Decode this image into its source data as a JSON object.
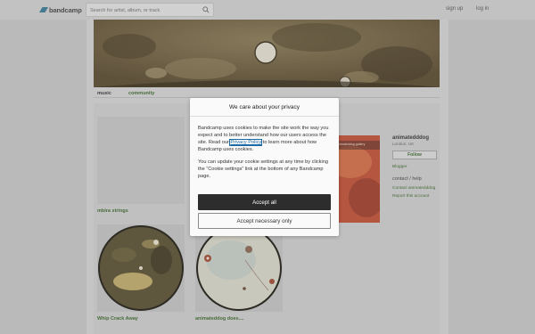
{
  "header": {
    "logo_text": "bandcamp",
    "search_placeholder": "Search for artist, album, or track",
    "signup_label": "sign up",
    "login_label": "log in"
  },
  "nav": {
    "music_label": "music",
    "community_label": "community"
  },
  "albums": [
    {
      "title": "mbira strings"
    },
    {
      "title": "Whip Crack Away"
    },
    {
      "title": "animateddog does...."
    }
  ],
  "featured_art_caption": "animateddog.gallery",
  "sidebar": {
    "band_name": "animatedddog",
    "location": "London, UK",
    "follow_label": "Follow",
    "blogger_link": "Blogger",
    "contact_heading": "contact / help",
    "contact_link": "Contact animatedddog",
    "report_link": "Report this account"
  },
  "cookie_modal": {
    "title": "We care about your privacy",
    "body_before_link": "Bandcamp uses cookies to make the site work the way you expect and to better understand how our users access the site. Read our ",
    "privacy_link": "Privacy Policy",
    "body_after_link": " to learn more about how Bandcamp uses cookies.",
    "settings_text": "You can update your cookie settings at any time by clicking the “Cookie settings” link at the bottom of any Bandcamp page.",
    "accept_all_label": "Accept all",
    "accept_necessary_label": "Accept necessary only"
  },
  "colors": {
    "link_green": "#3d6a2e",
    "modal_button_dark": "#2d2d2d",
    "logo_blue": "#3a7a95"
  },
  "icons": [
    "bandcamp-logo-icon",
    "search-icon"
  ]
}
